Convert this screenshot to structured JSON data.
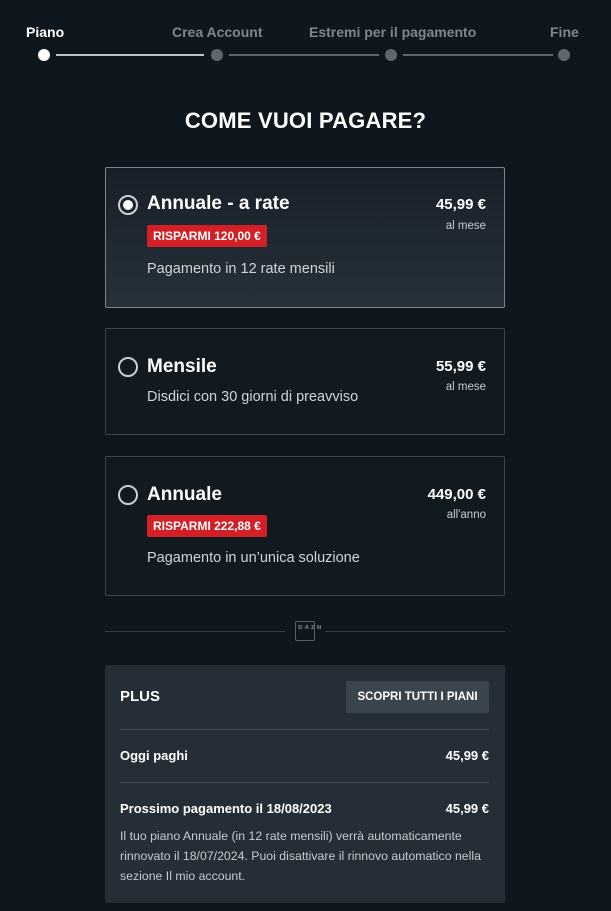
{
  "stepper": {
    "steps": [
      {
        "label": "Piano",
        "state": "active"
      },
      {
        "label": "Crea Account",
        "state": "pending"
      },
      {
        "label": "Estremi per il pagamento",
        "state": "pending"
      },
      {
        "label": "Fine",
        "state": "pending"
      }
    ]
  },
  "page": {
    "title": "COME VUOI PAGARE?"
  },
  "plans": [
    {
      "name": "Annuale - a rate",
      "badge": "RISPARMI 120,00 €",
      "description": "Pagamento in 12 rate mensili",
      "price": "45,99 €",
      "period": "al mese",
      "selected": true
    },
    {
      "name": "Mensile",
      "description": "Disdici con 30 giorni di preavviso",
      "price": "55,99 €",
      "period": "al mese",
      "selected": false
    },
    {
      "name": "Annuale",
      "badge": "RISPARMI 222,88 €",
      "description": "Pagamento in un’unica soluzione",
      "price": "449,00 €",
      "period": "all'anno",
      "selected": false
    }
  ],
  "divider": {
    "logo_text": "DAZN"
  },
  "summary": {
    "plan_name": "PLUS",
    "discover_button": "SCOPRI TUTTI I PIANI",
    "today_label": "Oggi paghi",
    "today_amount": "45,99 €",
    "next_label": "Prossimo pagamento il 18/08/2023",
    "next_amount": "45,99 €",
    "note": "Il tuo piano Annuale (in 12 rate mensili) verrà automaticamente rinnovato il 18/07/2024. Puoi disattivare il rinnovo automatico nella sezione Il mio account."
  },
  "colors": {
    "background": "#0f171e",
    "badge": "#d31f26",
    "summary_panel": "#252e37"
  }
}
